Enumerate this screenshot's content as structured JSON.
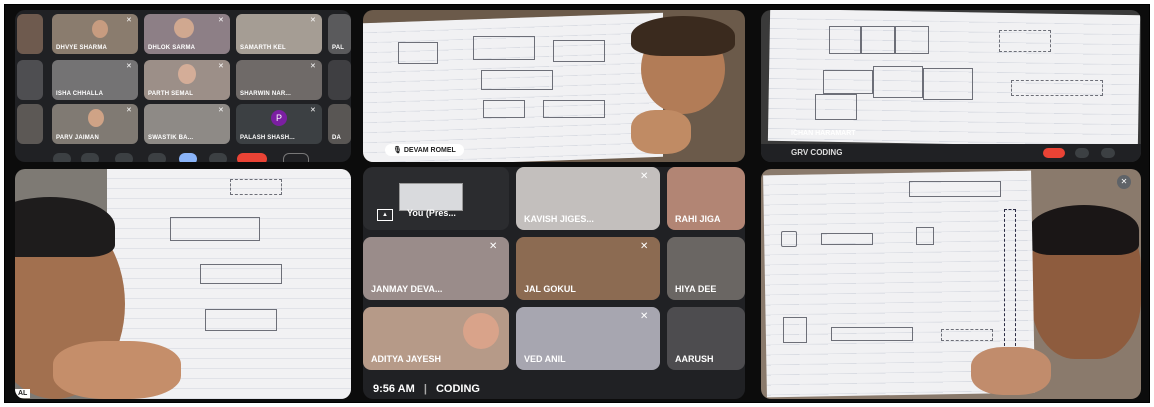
{
  "panels": {
    "gallery_top": {
      "tiles": [
        {
          "name": "DHVYE SHARMA"
        },
        {
          "name": "DHLOK SARMA"
        },
        {
          "name": "SAMARTH KEL"
        },
        {
          "name": "PAL"
        },
        {
          "name": "ISHA CHHALLA"
        },
        {
          "name": "PARTH SEMAL"
        },
        {
          "name": "SHARWIN NAR..."
        },
        {
          "name": "PARV JAIMAN"
        },
        {
          "name": "SWASTIK BA..."
        },
        {
          "name": "PALASH SHASH..."
        },
        {
          "name": "DA"
        }
      ],
      "avatar_letter": "P"
    },
    "top_middle": {
      "badge": "DEVAM ROMEL"
    },
    "top_right": {
      "name": "ICHAN HARAMART",
      "bottom_text": "GRV CODING"
    },
    "bottom_left": {
      "corner_text": "AL"
    },
    "bottom_middle": {
      "you_label": "You (Pres...",
      "tiles": [
        {
          "name": "KAVISH JIGES..."
        },
        {
          "name": "RAHI JIGA"
        },
        {
          "name": "JANMAY DEVA..."
        },
        {
          "name": "JAL GOKUL"
        },
        {
          "name": "HIYA DEE"
        },
        {
          "name": "ADITYA JAYESH"
        },
        {
          "name": "VED ANIL"
        },
        {
          "name": "AARUSH"
        }
      ],
      "time": "9:56 AM",
      "separator": "|",
      "meeting": "CODING"
    }
  },
  "icons": [
    "mic-off-icon",
    "present-icon",
    "end-call-icon",
    "camera-icon",
    "raise-hand-icon",
    "more-icon"
  ],
  "colors": {
    "end_call": "#ea4335",
    "active_control": "#8ab4f8",
    "avatar": "#7b1fa2"
  }
}
